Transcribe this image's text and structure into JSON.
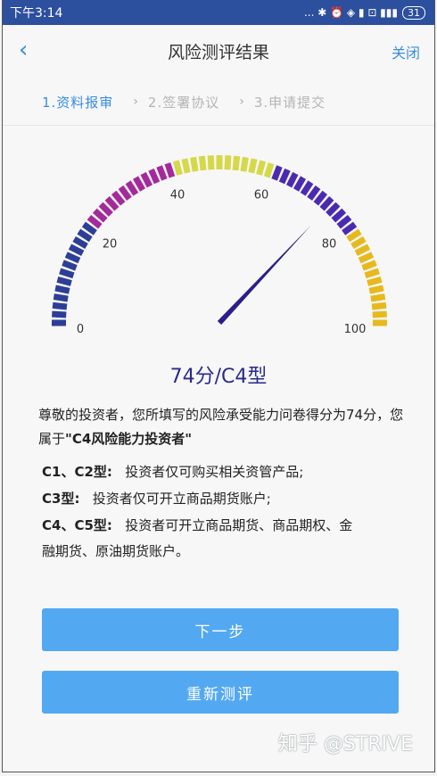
{
  "status_bar": {
    "time": "下午3:14",
    "icons": "... ✱ ⏰ ◈ ▮ ⊡ ▮▮▮",
    "battery": "31"
  },
  "nav": {
    "back_icon": "‹",
    "title": "风险测评结果",
    "close_label": "关闭"
  },
  "steps": [
    {
      "label": "1.资料报审",
      "active": true
    },
    {
      "label": "2.签署协议",
      "active": false
    },
    {
      "label": "3.申请提交",
      "active": false
    }
  ],
  "gauge": {
    "value": 74,
    "min": 0,
    "max": 100,
    "tick_labels": [
      "0",
      "20",
      "40",
      "60",
      "80",
      "100"
    ],
    "segments": [
      {
        "from": 0,
        "to": 20,
        "color": "#2d3e98"
      },
      {
        "from": 20,
        "to": 40,
        "color": "#a42a9b"
      },
      {
        "from": 40,
        "to": 60,
        "color": "#d6d84a"
      },
      {
        "from": 60,
        "to": 80,
        "color": "#4a2bb0"
      },
      {
        "from": 80,
        "to": 100,
        "color": "#e7b91e"
      }
    ],
    "needle_color": "#2a1f8a"
  },
  "result": {
    "score_text": "74分/C4型",
    "desc_prefix": "尊敬的投资者，您所填写的风险承受能力问卷得分为74分，您属于",
    "desc_bold": "\"C4风险能力投资者\""
  },
  "types": [
    {
      "name": "C1、C2型:",
      "text": "投资者仅可购买相关资管产品;"
    },
    {
      "name": "C3型:",
      "text": "投资者仅可开立商品期货账户;"
    },
    {
      "name": "C4、C5型:",
      "text": "投资者可开立商品期货、商品期权、金",
      "cont": "融期货、原油期货账户。"
    }
  ],
  "buttons": {
    "next": "下一步",
    "retest": "重新测评"
  },
  "watermark": "知乎 @STRIVE",
  "colors": {
    "status_bar": "#2c4f9e",
    "accent": "#3a8de0",
    "button": "#53a8f2"
  }
}
